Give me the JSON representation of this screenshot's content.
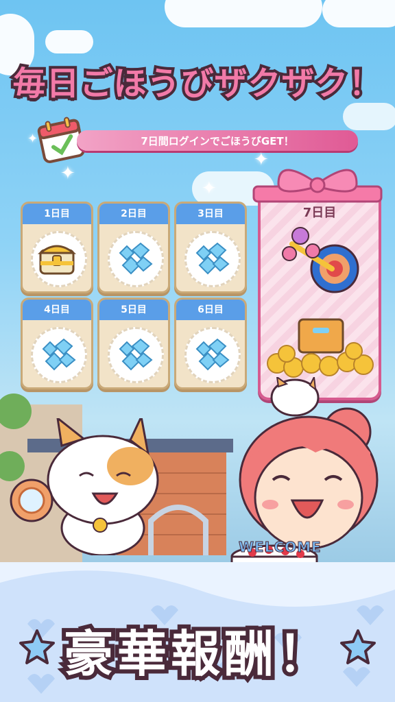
{
  "title": "毎日ごほうびザクザク！",
  "subtitle": "7日間ログインでごほうびGET！",
  "days": [
    {
      "label": "1日目",
      "reward": "treasure-chest-icon"
    },
    {
      "label": "2日目",
      "reward": "gems-icon"
    },
    {
      "label": "3日目",
      "reward": "gems-icon"
    },
    {
      "label": "4日目",
      "reward": "gems-icon"
    },
    {
      "label": "5日目",
      "reward": "gems-icon"
    },
    {
      "label": "6日目",
      "reward": "gems-icon"
    }
  ],
  "day7": {
    "label": "7日目",
    "rewards": [
      "magic-wand-icon",
      "gold-coins-box-icon"
    ]
  },
  "cake_text": "WELCOME",
  "bottom_banner": "豪華報酬！",
  "colors": {
    "title": "#f27aa8",
    "header_blue": "#5a9ee8",
    "pink": "#d65b8f",
    "outline": "#4a2a3a"
  }
}
